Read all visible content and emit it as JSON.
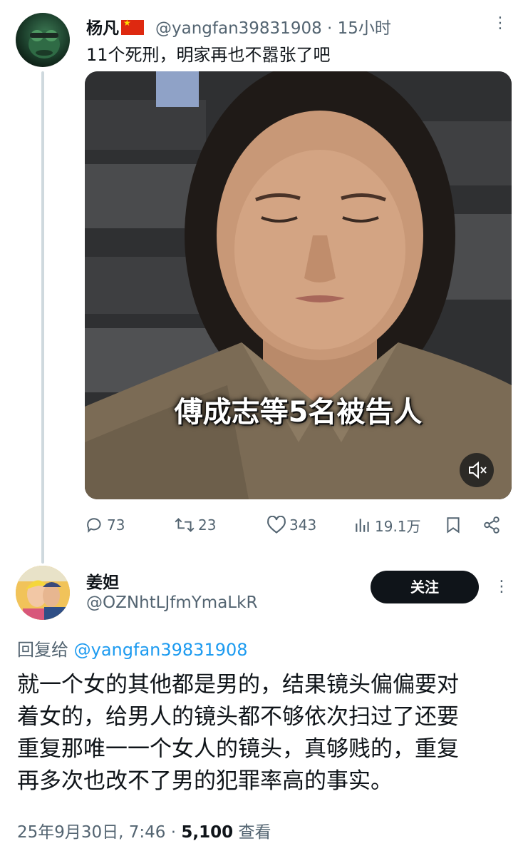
{
  "tweet": {
    "author_name": "杨凡",
    "handle": "@yangfan39831908",
    "separator": "·",
    "time_ago": "15小时",
    "text": "11个死刑，明家再也不嚣张了吧",
    "video_caption": "傅成志等5名被告人",
    "stats": {
      "replies": "73",
      "retweets": "23",
      "likes": "343",
      "views": "19.1万"
    }
  },
  "reply": {
    "author_name": "姜妲",
    "handle": "@OZNhtLJfmYmaLkR",
    "follow_label": "关注",
    "reply_to_label": "回复给",
    "reply_to_handle": "@yangfan39831908",
    "text_lines": [
      "就一个女的其他都是男的，结果镜头偏偏要对",
      "着女的，给男人的镜头都不够依次扫过了还要",
      "重复那唯一一个女人的镜头，真够贱的，重复",
      "再多次也改不了男的犯罪率高的事实。"
    ],
    "date": "25年9月30日, 7:46",
    "dot": "·",
    "view_count": "5,100",
    "view_label": "查看"
  },
  "colors": {
    "text_primary": "#0f1419",
    "text_secondary": "#536471",
    "link": "#1d9bf0",
    "follow_button_bg": "#0f1419",
    "thread_line": "#cfd9de"
  },
  "icons": {
    "more": "more-icon",
    "reply": "reply-icon",
    "retweet": "retweet-icon",
    "like": "heart-icon",
    "views": "views-icon",
    "bookmark": "bookmark-icon",
    "share": "share-icon",
    "mute": "mute-icon"
  }
}
